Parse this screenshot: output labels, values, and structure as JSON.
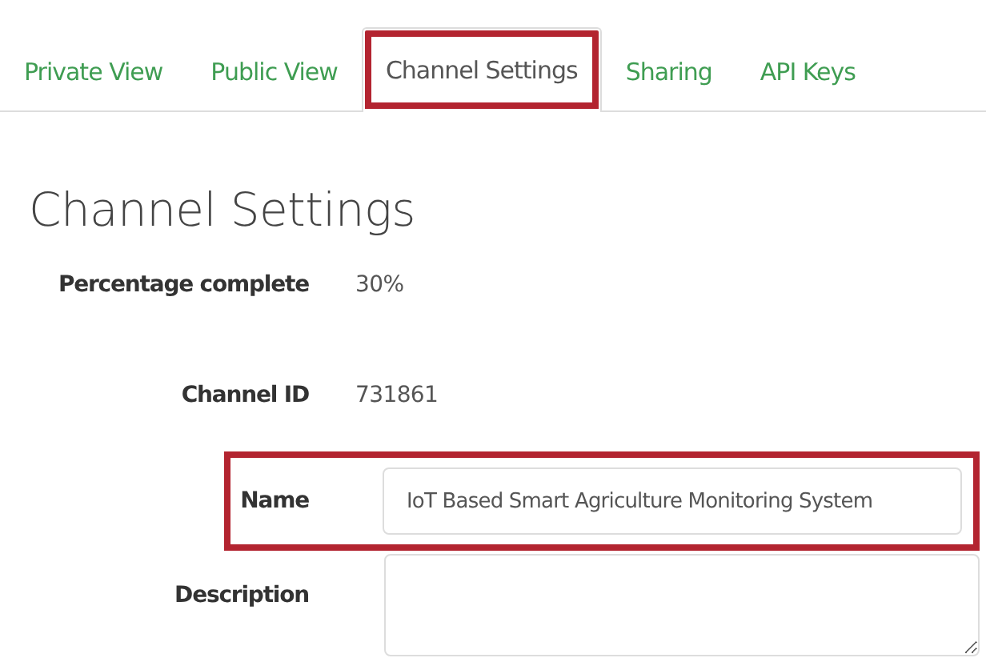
{
  "tabs": [
    {
      "label": "Private View",
      "selected": false,
      "highlighted": false
    },
    {
      "label": "Public View",
      "selected": false,
      "highlighted": false
    },
    {
      "label": "Channel Settings",
      "selected": true,
      "highlighted": true
    },
    {
      "label": "Sharing",
      "selected": false,
      "highlighted": false
    },
    {
      "label": "API Keys",
      "selected": false,
      "highlighted": false
    }
  ],
  "heading": "Channel Settings",
  "fields": [
    {
      "kind": "text",
      "label": "Percentage complete",
      "value": "30%",
      "highlighted": false
    },
    {
      "kind": "text",
      "label": "Channel ID",
      "value": "731861",
      "highlighted": false
    },
    {
      "kind": "input",
      "label": "Name",
      "value": "IoT Based Smart Agriculture Monitoring System",
      "highlighted": true
    },
    {
      "kind": "textarea",
      "label": "Description",
      "highlighted": false
    }
  ]
}
